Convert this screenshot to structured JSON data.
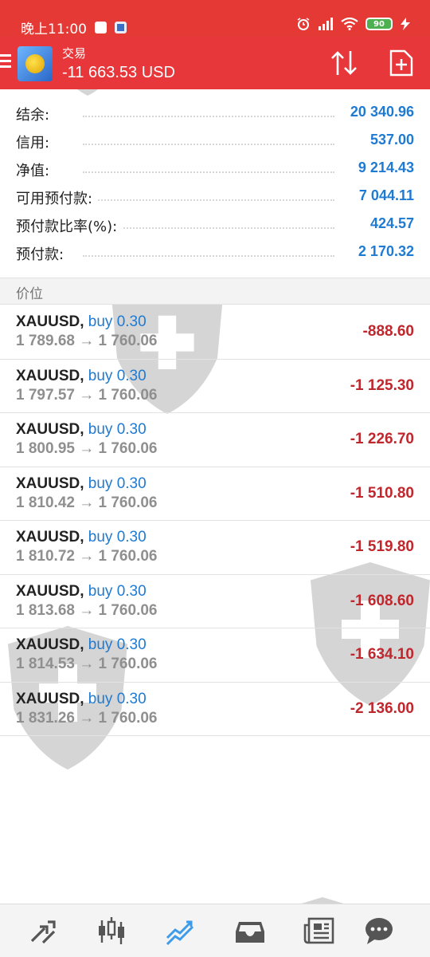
{
  "status_bar": {
    "time": "晚上11:00",
    "battery": "90"
  },
  "header": {
    "title": "交易",
    "balance_summary": "-11 663.53 USD"
  },
  "account": [
    {
      "label": "结余:",
      "value": "20 340.96"
    },
    {
      "label": "信用:",
      "value": "537.00"
    },
    {
      "label": "净值:",
      "value": "9 214.43"
    },
    {
      "label": "可用预付款:",
      "value": "7 044.11"
    },
    {
      "label": "预付款比率(%):",
      "value": "424.57"
    },
    {
      "label": "预付款:",
      "value": "2 170.32"
    }
  ],
  "section_title": "价位",
  "positions": [
    {
      "symbol": "XAUUSD,",
      "side": "buy 0.30",
      "prices": "1 789.68 → 1 760.06",
      "profit": "-888.60"
    },
    {
      "symbol": "XAUUSD,",
      "side": "buy 0.30",
      "prices": "1 797.57 → 1 760.06",
      "profit": "-1 125.30"
    },
    {
      "symbol": "XAUUSD,",
      "side": "buy 0.30",
      "prices": "1 800.95 → 1 760.06",
      "profit": "-1 226.70"
    },
    {
      "symbol": "XAUUSD,",
      "side": "buy 0.30",
      "prices": "1 810.42 → 1 760.06",
      "profit": "-1 510.80"
    },
    {
      "symbol": "XAUUSD,",
      "side": "buy 0.30",
      "prices": "1 810.72 → 1 760.06",
      "profit": "-1 519.80"
    },
    {
      "symbol": "XAUUSD,",
      "side": "buy 0.30",
      "prices": "1 813.68 → 1 760.06",
      "profit": "-1 608.60"
    },
    {
      "symbol": "XAUUSD,",
      "side": "buy 0.30",
      "prices": "1 814.53 → 1 760.06",
      "profit": "-1 634.10"
    },
    {
      "symbol": "XAUUSD,",
      "side": "buy 0.30",
      "prices": "1 831.26 → 1 760.06",
      "profit": "-2 136.00"
    }
  ],
  "bottom_nav": [
    {
      "name": "quotes",
      "icon": "arrows-diagonal-icon"
    },
    {
      "name": "chart",
      "icon": "candlestick-icon"
    },
    {
      "name": "trade",
      "icon": "trend-lines-icon",
      "active": true
    },
    {
      "name": "history",
      "icon": "inbox-icon"
    },
    {
      "name": "news",
      "icon": "newspaper-icon"
    },
    {
      "name": "messages",
      "icon": "chat-bubble-icon"
    }
  ],
  "colors": {
    "header_red": "#e8373a",
    "value_blue": "#1f7ad1",
    "loss_red": "#c0272d",
    "active_nav": "#3d9be9"
  }
}
